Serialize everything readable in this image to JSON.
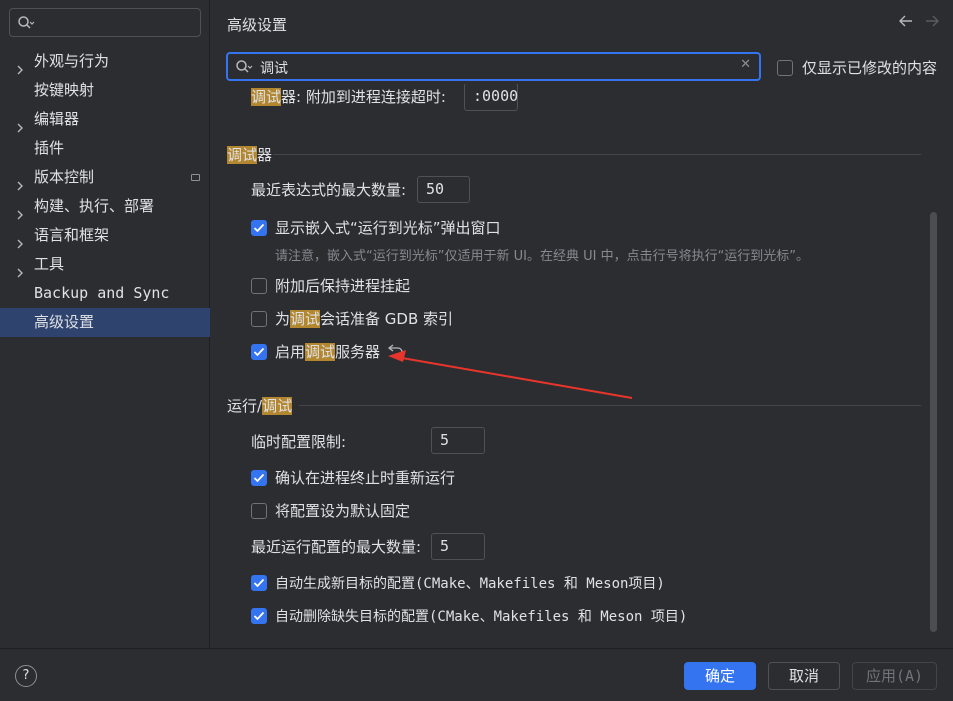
{
  "sidebar": {
    "search_value": "",
    "items": [
      {
        "label": "外观与行为",
        "expandable": true
      },
      {
        "label": "按键映射",
        "expandable": false
      },
      {
        "label": "编辑器",
        "expandable": true
      },
      {
        "label": "插件",
        "expandable": false
      },
      {
        "label": "版本控制",
        "expandable": true
      },
      {
        "label": "构建、执行、部署",
        "expandable": true
      },
      {
        "label": "语言和框架",
        "expandable": true
      },
      {
        "label": "工具",
        "expandable": true
      },
      {
        "label": "Backup and Sync",
        "expandable": false
      },
      {
        "label": "高级设置",
        "expandable": false,
        "selected": true
      }
    ]
  },
  "header": {
    "title": "高级设置",
    "search_value": "调试",
    "modified_only_label": "仅显示已修改的内容"
  },
  "attach": {
    "label_hl": "调试",
    "label_rest": "器: 附加到进程连接超时:",
    "value": ":0000"
  },
  "debugger": {
    "section_hl": "调试",
    "section_rest": "器",
    "max_expr_label": "最近表达式的最大数量:",
    "max_expr_value": "50",
    "inline_popup_label": "显示嵌入式“运行到光标”弹出窗口",
    "inline_popup_hint": "请注意，嵌入式“运行到光标”仅适用于新 UI。在经典 UI 中，点击行号将执行“运行到光标”。",
    "keep_suspended_label": "附加后保持进程挂起",
    "gdb_index_pre": "为",
    "gdb_index_hl": "调试",
    "gdb_index_post": "会话准备 GDB 索引",
    "server_pre": "启用",
    "server_hl": "调试",
    "server_post": "服务器"
  },
  "run_debug": {
    "section_pre": "运行/",
    "section_hl": "调试",
    "temp_limit_label": "临时配置限制:",
    "temp_limit_value": "5",
    "confirm_rerun_label": "确认在进程终止时重新运行",
    "default_pinned_label": "将配置设为默认固定",
    "recent_max_label": "最近运行配置的最大数量:",
    "recent_max_value": "5",
    "auto_create_label": "自动生成新目标的配置(CMake、Makefiles 和 Meson项目)",
    "auto_delete_label": "自动删除缺失目标的配置(CMake、Makefiles 和 Meson 项目)"
  },
  "footer": {
    "help": "?",
    "ok": "确定",
    "cancel": "取消",
    "apply": "应用(A)"
  },
  "colors": {
    "accent": "#3574f0",
    "highlight": "#b3872f",
    "annotation_arrow": "#e8352c"
  }
}
